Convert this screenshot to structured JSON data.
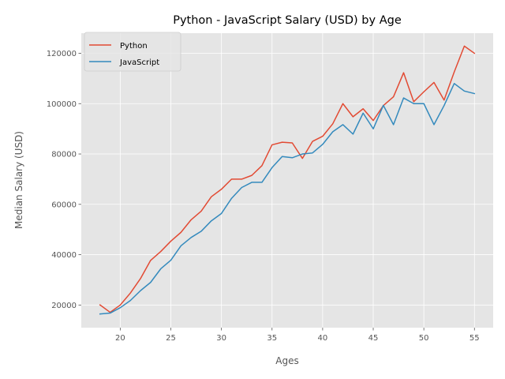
{
  "chart_data": {
    "type": "line",
    "title": "Python - JavaScript Salary (USD) by Age",
    "xlabel": "Ages",
    "ylabel": "Median Salary (USD)",
    "xlim": [
      16.15,
      56.85
    ],
    "ylim": [
      11000,
      128000
    ],
    "xticks": [
      20,
      25,
      30,
      35,
      40,
      45,
      50,
      55
    ],
    "yticks": [
      20000,
      40000,
      60000,
      80000,
      100000,
      120000
    ],
    "grid": true,
    "legend_position": "upper-left",
    "x": [
      18,
      19,
      20,
      21,
      22,
      23,
      24,
      25,
      26,
      27,
      28,
      29,
      30,
      31,
      32,
      33,
      34,
      35,
      36,
      37,
      38,
      39,
      40,
      41,
      42,
      43,
      44,
      45,
      46,
      47,
      48,
      49,
      50,
      51,
      52,
      53,
      54,
      55
    ],
    "series": [
      {
        "name": "Python",
        "color": "#E24A33",
        "values": [
          20046,
          17100,
          20000,
          24744,
          30500,
          37732,
          41247,
          45372,
          48876,
          53850,
          57287,
          63016,
          65998,
          70003,
          70000,
          71496,
          75370,
          83640,
          84666,
          84392,
          78254,
          85000,
          87038,
          91991,
          100000,
          94796,
          97962,
          93302,
          99240,
          102736,
          112285,
          100771,
          104708,
          108423,
          101407,
          112542,
          122870,
          120000
        ]
      },
      {
        "name": "JavaScript",
        "color": "#348ABD",
        "values": [
          16446,
          16791,
          18942,
          21780,
          25704,
          29000,
          34372,
          37810,
          43515,
          46823,
          49293,
          53437,
          56373,
          62375,
          66674,
          68745,
          68746,
          74583,
          79000,
          78508,
          79996,
          80403,
          83820,
          88833,
          91660,
          87892,
          96243,
          90000,
          99313,
          91660,
          102264,
          100000,
          100000,
          91660,
          99240,
          108000,
          105000,
          104000
        ]
      }
    ]
  }
}
